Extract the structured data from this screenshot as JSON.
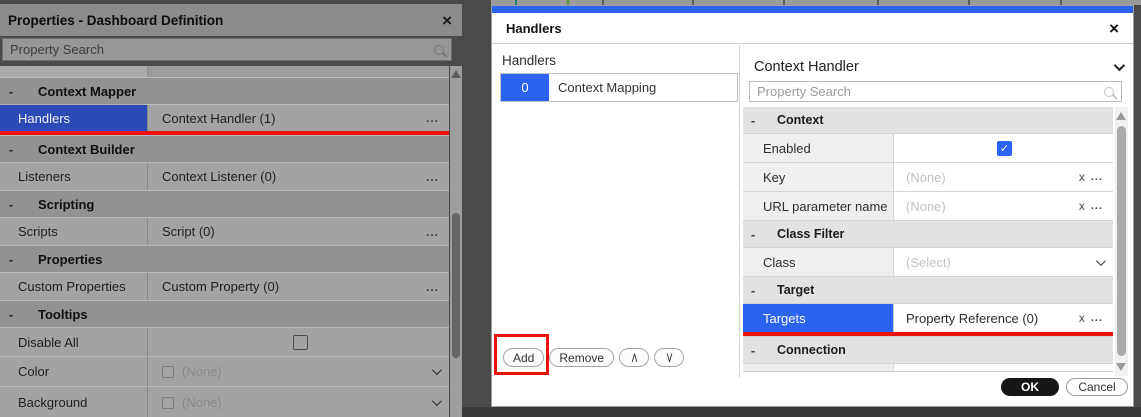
{
  "left_panel": {
    "title": "Properties - Dashboard Definition",
    "close": "×",
    "search_placeholder": "Property Search",
    "collapse_glyph": "-",
    "ellipsis": "...",
    "sections": [
      {
        "label": "Context Mapper"
      },
      {
        "label": "Context Builder"
      },
      {
        "label": "Scripting"
      },
      {
        "label": "Properties"
      },
      {
        "label": "Tooltips"
      }
    ],
    "rows": [
      {
        "name": "Handlers",
        "value": "Context Handler (1)",
        "selected": true
      },
      {
        "name": "Listeners",
        "value": "Context Listener (0)"
      },
      {
        "name": "Scripts",
        "value": "Script (0)"
      },
      {
        "name": "Custom Properties",
        "value": "Custom Property (0)"
      },
      {
        "name": "Disable All",
        "value": ""
      },
      {
        "name": "Color",
        "value": "(None)"
      },
      {
        "name": "Background",
        "value": "(None)"
      }
    ]
  },
  "dialog": {
    "title": "Handlers",
    "close": "×",
    "list": {
      "header": "Handlers",
      "items": [
        {
          "index": "0",
          "label": "Context Mapping"
        }
      ]
    },
    "buttons": {
      "add": "Add",
      "remove": "Remove",
      "move_up": "/\\",
      "move_down": "\\/"
    },
    "detail": {
      "type_selector": "Context Handler",
      "search_placeholder": "Property Search",
      "collapse_glyph": "-",
      "sections": [
        {
          "label": "Context"
        },
        {
          "label": "Class Filter"
        },
        {
          "label": "Target"
        },
        {
          "label": "Connection"
        }
      ],
      "rows": [
        {
          "name": "Enabled",
          "checked": true
        },
        {
          "name": "Key",
          "value": "(None)",
          "clear": "x",
          "more": "..."
        },
        {
          "name": "URL parameter name",
          "value": "(None)",
          "clear": "x",
          "more": "..."
        },
        {
          "name": "Class",
          "value": "(Select)"
        },
        {
          "name": "Targets",
          "value": "Property Reference (0)",
          "clear": "x",
          "more": "...",
          "selected": true
        }
      ]
    },
    "footer": {
      "ok": "OK",
      "cancel": "Cancel"
    }
  },
  "icons": {
    "checkmark": "✓"
  },
  "colors": {
    "accent_blue": "#2a63f0",
    "dimmed_selected_blue": "#2b4ab5",
    "annotation_red": "#e8140c",
    "ok_button": "#161616"
  }
}
